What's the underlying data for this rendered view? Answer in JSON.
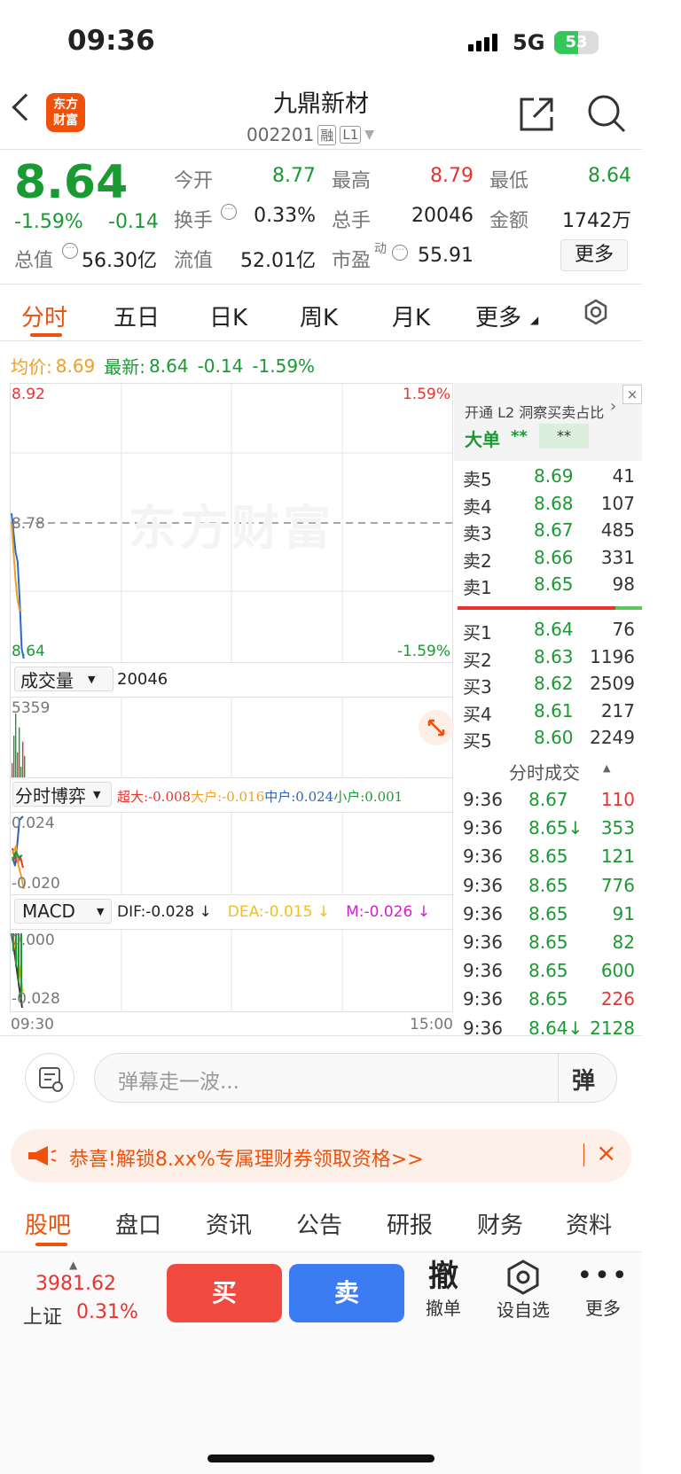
{
  "status": {
    "time": "09:36",
    "network": "5G",
    "battery": "53"
  },
  "header": {
    "logo_line1": "东方",
    "logo_line2": "财富",
    "name": "九鼎新材",
    "code": "002201",
    "tag1": "融",
    "tag2": "L1"
  },
  "quote": {
    "price": "8.64",
    "pct": "-1.59%",
    "chg": "-0.14",
    "open_label": "今开",
    "open": "8.77",
    "high_label": "最高",
    "high": "8.79",
    "low_label": "最低",
    "low": "8.64",
    "turnover_label": "换手",
    "turnover": "0.33%",
    "vol_label": "总手",
    "vol": "20046",
    "amt_label": "金额",
    "amt": "1742万",
    "mcap_label": "总值",
    "mcap": "56.30亿",
    "float_label": "流值",
    "float": "52.01亿",
    "pe_label": "市盈",
    "pe_sup": "动",
    "pe": "55.91",
    "more": "更多"
  },
  "tabs": [
    "分时",
    "五日",
    "日K",
    "周K",
    "月K",
    "更多"
  ],
  "avgline": {
    "avg_label": "均价:",
    "avg": "8.69",
    "last_label": "最新:",
    "last": "8.64",
    "chg": "-0.14",
    "pct": "-1.59%"
  },
  "chart_data": [
    {
      "type": "line",
      "ylim": [
        8.64,
        8.92
      ],
      "y_tick_labels": [
        "8.92",
        "8.78",
        "8.64"
      ],
      "right_tick_labels": [
        "1.59%",
        "-1.59%"
      ],
      "prev_close": "8.78",
      "watermark": "东方财富",
      "series": [
        {
          "values": [
            8.79,
            8.77,
            8.75,
            8.74,
            8.7,
            8.65,
            8.64
          ]
        },
        {
          "values": [
            8.78,
            8.75,
            8.72,
            8.7,
            8.69,
            8.69
          ]
        }
      ]
    },
    {
      "type": "bar",
      "label": "成交量",
      "total": "20046",
      "y_tick_labels": [
        "5359"
      ],
      "values": [
        1200,
        3500,
        5359,
        2100,
        4200,
        900,
        3000,
        1800
      ]
    },
    {
      "type": "line",
      "label": "分时博弈",
      "ylim": [
        -0.02,
        0.024
      ],
      "y_tick_labels": [
        "0.024",
        "-0.020"
      ],
      "legend": [
        {
          "name": "超大",
          "value": ":-0.008"
        },
        {
          "name": "大户",
          "value": ":-0.016"
        },
        {
          "name": "中户",
          "value": ":0.024"
        },
        {
          "name": "小户",
          "value": ":0.001"
        }
      ]
    },
    {
      "type": "line",
      "label": "MACD",
      "ylim": [
        -0.028,
        0.0
      ],
      "y_tick_labels": [
        "0.000",
        "-0.028"
      ],
      "legend": [
        {
          "name": "DIF:",
          "value": "-0.028 ↓"
        },
        {
          "name": "DEA:",
          "value": "-0.015 ↓"
        },
        {
          "name": "M:",
          "value": "-0.026 ↓"
        }
      ],
      "x_tick_labels": [
        "09:30",
        "15:00"
      ]
    }
  ],
  "l2": {
    "title": "开通 L2 洞察买卖占比",
    "big": "大单",
    "stars1": "**",
    "stars2": "**"
  },
  "asks": [
    {
      "l": "卖5",
      "p": "8.69",
      "v": "41"
    },
    {
      "l": "卖4",
      "p": "8.68",
      "v": "107"
    },
    {
      "l": "卖3",
      "p": "8.67",
      "v": "485"
    },
    {
      "l": "卖2",
      "p": "8.66",
      "v": "331"
    },
    {
      "l": "卖1",
      "p": "8.65",
      "v": "98"
    }
  ],
  "bids": [
    {
      "l": "买1",
      "p": "8.64",
      "v": "76"
    },
    {
      "l": "买2",
      "p": "8.63",
      "v": "1196"
    },
    {
      "l": "买3",
      "p": "8.62",
      "v": "2509"
    },
    {
      "l": "买4",
      "p": "8.61",
      "v": "217"
    },
    {
      "l": "买5",
      "p": "8.60",
      "v": "2249"
    }
  ],
  "ticks_title": "分时成交",
  "ticks": [
    {
      "t": "9:36",
      "p": "8.67",
      "v": "110",
      "c": "red"
    },
    {
      "t": "9:36",
      "p": "8.65↓",
      "v": "353",
      "c": "green"
    },
    {
      "t": "9:36",
      "p": "8.65",
      "v": "121",
      "c": "green"
    },
    {
      "t": "9:36",
      "p": "8.65",
      "v": "776",
      "c": "green"
    },
    {
      "t": "9:36",
      "p": "8.65",
      "v": "91",
      "c": "green"
    },
    {
      "t": "9:36",
      "p": "8.65",
      "v": "82",
      "c": "green"
    },
    {
      "t": "9:36",
      "p": "8.65",
      "v": "600",
      "c": "green"
    },
    {
      "t": "9:36",
      "p": "8.65",
      "v": "226",
      "c": "red"
    },
    {
      "t": "9:36",
      "p": "8.64↓",
      "v": "2128",
      "c": "green"
    }
  ],
  "danmu": {
    "placeholder": "弹幕走一波...",
    "btn": "弹"
  },
  "banner": {
    "text": "恭喜!解锁8.xx%专属理财券领取资格>>"
  },
  "subtabs": [
    "股吧",
    "盘口",
    "资讯",
    "公告",
    "研报",
    "财务",
    "资料"
  ],
  "bottom": {
    "index_value": "3981.62",
    "index_name": "上证",
    "index_pct": "0.31%",
    "buy": "买",
    "sell": "卖",
    "cancel_icon": "撤",
    "cancel": "撤单",
    "watch": "设自选",
    "more": "更多"
  },
  "colors": {
    "up": "#e8332e",
    "down": "#1a9a32",
    "accent": "#f0500a",
    "avg": "#f0a020",
    "buy": "#f04b3e",
    "sell": "#3b7cf2"
  }
}
